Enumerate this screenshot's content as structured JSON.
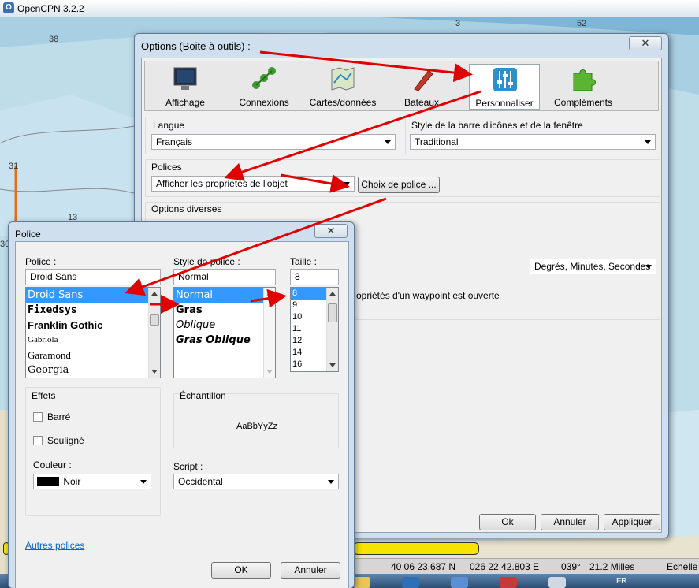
{
  "app": {
    "title": "OpenCPN 3.2.2"
  },
  "chart": {
    "depths": [
      "38",
      "3",
      "52",
      "31",
      "13",
      "30"
    ]
  },
  "options_dialog": {
    "title": "Options (Boite à outils) :",
    "close_icon": "close-icon",
    "tabs": [
      {
        "label": "Affichage",
        "icon": "display-monitor-icon"
      },
      {
        "label": "Connexions",
        "icon": "connections-icon"
      },
      {
        "label": "Cartes/données",
        "icon": "charts-icon"
      },
      {
        "label": "Bateaux",
        "icon": "boats-icon"
      },
      {
        "label": "Personnaliser",
        "icon": "sliders-icon"
      },
      {
        "label": "Compléments",
        "icon": "puzzle-icon"
      }
    ],
    "langue": {
      "label": "Langue",
      "value": "Français"
    },
    "style": {
      "label": "Style de la barre d'icônes et de la fenêtre",
      "value": "Traditional"
    },
    "polices": {
      "label": "Polices",
      "value": "Afficher les propriétés de l'objet",
      "button": "Choix de police ..."
    },
    "diverses": {
      "label": "Options diverses",
      "format_value": "Degrés, Minutes, Secondes",
      "waypoint_text": "opriétés d'un waypoint est ouverte"
    },
    "buttons": {
      "ok": "Ok",
      "annuler": "Annuler",
      "appliquer": "Appliquer"
    }
  },
  "police_dialog": {
    "title": "Police",
    "police_label": "Police :",
    "police_value": "Droid Sans",
    "fonts": [
      "Droid Sans",
      "Fixedsys",
      "Franklin Gothic",
      "Gabriola",
      "Garamond",
      "Georgia"
    ],
    "style_label": "Style de police :",
    "style_value": "Normal",
    "styles": [
      "Normal",
      "Gras",
      "Oblique",
      "Gras Oblique"
    ],
    "taille_label": "Taille :",
    "taille_value": "8",
    "sizes": [
      "8",
      "9",
      "10",
      "11",
      "12",
      "14",
      "16"
    ],
    "effets_label": "Effets",
    "barre_label": "Barré",
    "souligne_label": "Souligné",
    "couleur_label": "Couleur :",
    "couleur_value": "Noir",
    "couleur_swatch": "#000000",
    "echantillon_label": "Échantillon",
    "sample_text": "AaBbYyZz",
    "script_label": "Script :",
    "script_value": "Occidental",
    "autres_link": "Autres polices",
    "ok": "OK",
    "annuler": "Annuler"
  },
  "status": {
    "lat": "40 06 23.687 N",
    "lon": "026 22 42.803 E",
    "heading": "039°",
    "distance": "21.2 Milles",
    "scale": "Echelle"
  },
  "taskbar": {
    "lang": "FR"
  },
  "colors": {
    "accent": "#3399ff",
    "annotation": "#e00000",
    "progress": "#f6e400"
  }
}
